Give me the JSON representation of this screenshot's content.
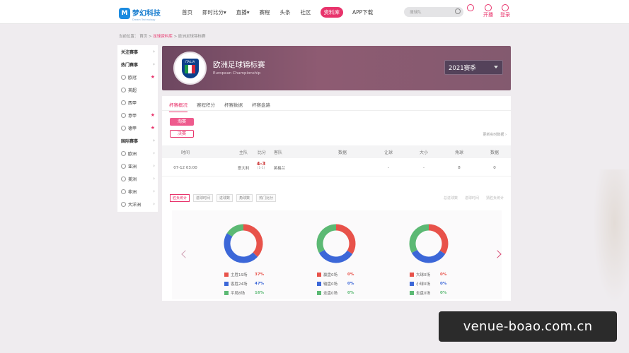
{
  "brand": {
    "name": "梦幻科技",
    "sub": "Dream Technology",
    "mark": "M"
  },
  "nav": [
    {
      "label": "首页"
    },
    {
      "label": "即时比分▾"
    },
    {
      "label": "直播▾"
    },
    {
      "label": "赛程"
    },
    {
      "label": "头条"
    },
    {
      "label": "社区"
    },
    {
      "label": "资料库",
      "active": true
    },
    {
      "label": "APP下载"
    }
  ],
  "search": {
    "placeholder": "搜球队"
  },
  "top_actions": {
    "live": "开播",
    "login": "登录"
  },
  "breadcrumb": {
    "prefix": "当前位置：",
    "home": "首页",
    "library": "足球资料库",
    "current": "欧洲足球锦标赛",
    "sep": " > "
  },
  "sidebar": [
    {
      "label": "关注赛事",
      "type": "head"
    },
    {
      "label": "热门赛事",
      "type": "head"
    },
    {
      "label": "欧冠",
      "type": "fav"
    },
    {
      "label": "英超",
      "type": "plain"
    },
    {
      "label": "西甲",
      "type": "plain"
    },
    {
      "label": "意甲",
      "type": "fav"
    },
    {
      "label": "德甲",
      "type": "fav"
    },
    {
      "label": "国际赛事",
      "type": "head"
    },
    {
      "label": "欧洲",
      "type": "region"
    },
    {
      "label": "亚洲",
      "type": "region"
    },
    {
      "label": "美洲",
      "type": "region"
    },
    {
      "label": "非洲",
      "type": "region"
    },
    {
      "label": "大洋洲",
      "type": "region"
    }
  ],
  "league": {
    "badge_text": "ITALIA",
    "title": "欧洲足球锦标赛",
    "subtitle": "European Championship",
    "season": "2021赛季"
  },
  "tabs": [
    "杯赛概况",
    "赛程积分",
    "杯赛数据",
    "杯赛盘路"
  ],
  "filters": [
    "淘赛",
    "决赛"
  ],
  "more": "更新实时数据 ›",
  "table": {
    "headers": [
      "时间",
      "主队",
      "比分",
      "客队",
      "数据",
      "让球",
      "大小",
      "角球",
      "数据"
    ],
    "rows": [
      {
        "time": "07-12 03:00",
        "home": "意大利",
        "score": "4-3",
        "half": "(1-1)",
        "away": "英格兰",
        "data": "",
        "handicap": "-",
        "ou": "-",
        "corner": "8",
        "data2": "0"
      }
    ]
  },
  "stat_tabs": [
    "胜负统计",
    "进球时间",
    "进球数",
    "角球数",
    "热门比分"
  ],
  "stat_links": [
    "总进球数",
    "进球时间",
    "猜胜负统计"
  ],
  "charts": [
    {
      "legend": [
        {
          "label": "主胜19场",
          "pct": "37%",
          "color": "#e8524a"
        },
        {
          "label": "客胜24场",
          "pct": "47%",
          "color": "#3c67d8"
        },
        {
          "label": "平局8场",
          "pct": "16%",
          "color": "#5cb974"
        }
      ]
    },
    {
      "legend": [
        {
          "label": "赢盘0场",
          "pct": "0%",
          "color": "#e8524a"
        },
        {
          "label": "输盘0场",
          "pct": "0%",
          "color": "#3c67d8"
        },
        {
          "label": "走盘0场",
          "pct": "0%",
          "color": "#5cb974"
        }
      ]
    },
    {
      "legend": [
        {
          "label": "大球0场",
          "pct": "0%",
          "color": "#e8524a"
        },
        {
          "label": "小球0场",
          "pct": "0%",
          "color": "#3c67d8"
        },
        {
          "label": "走盘0场",
          "pct": "0%",
          "color": "#5cb974"
        }
      ]
    }
  ],
  "watermark": "venue-boao.com.cn"
}
